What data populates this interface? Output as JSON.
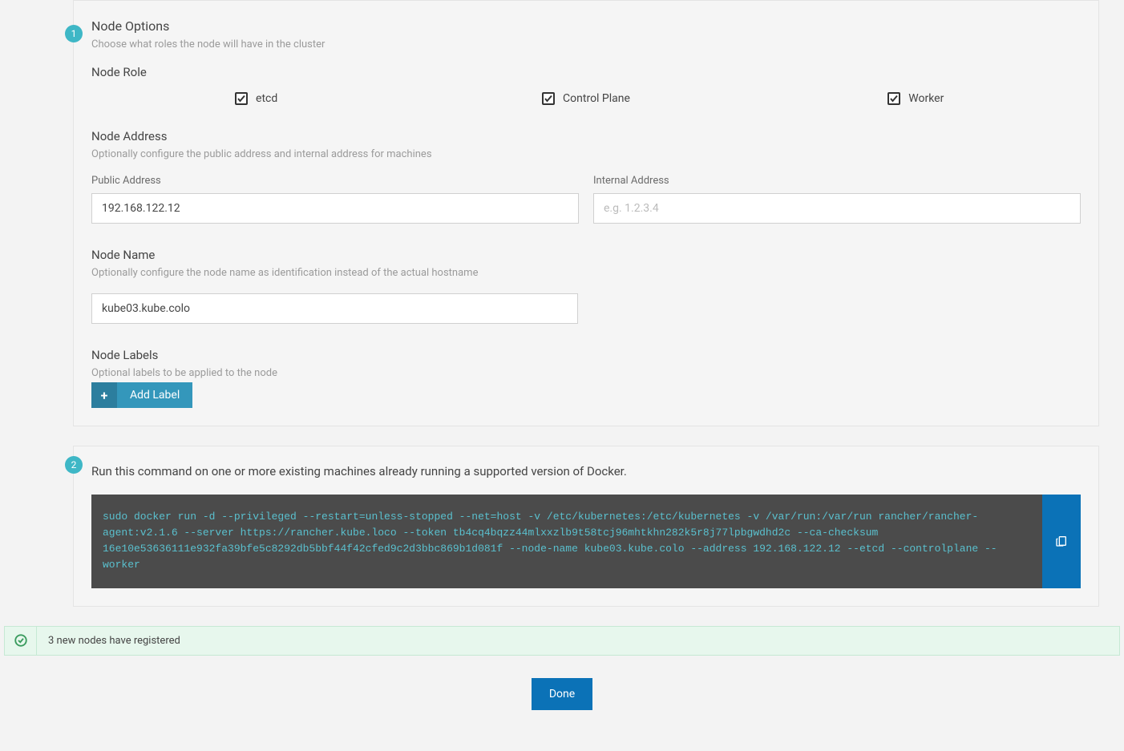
{
  "step1": {
    "badge": "1",
    "title": "Node Options",
    "desc": "Choose what roles the node will have in the cluster",
    "role_title": "Node Role",
    "roles": {
      "etcd": "etcd",
      "control_plane": "Control Plane",
      "worker": "Worker"
    },
    "address": {
      "title": "Node Address",
      "desc": "Optionally configure the public address and internal address for machines",
      "public_label": "Public Address",
      "public_value": "192.168.122.12",
      "internal_label": "Internal Address",
      "internal_placeholder": "e.g. 1.2.3.4",
      "internal_value": ""
    },
    "name": {
      "title": "Node Name",
      "desc": "Optionally configure the node name as identification instead of the actual hostname",
      "value": "kube03.kube.colo"
    },
    "labels": {
      "title": "Node Labels",
      "desc": "Optional labels to be applied to the node",
      "button": "Add Label"
    }
  },
  "step2": {
    "badge": "2",
    "instruction": "Run this command on one or more existing machines already running a supported version of Docker.",
    "command": "sudo docker run -d --privileged --restart=unless-stopped --net=host -v /etc/kubernetes:/etc/kubernetes -v /var/run:/var/run rancher/rancher-agent:v2.1.6 --server https://rancher.kube.loco --token tb4cq4bqzz44mlxxzlb9t58tcj96mhtkhn282k5r8j77lpbgwdhd2c --ca-checksum 16e10e53636111e932fa39bfe5c8292db5bbf44f42cfed9c2d3bbc869b1d081f --node-name kube03.kube.colo --address 192.168.122.12 --etcd --controlplane --worker"
  },
  "status": {
    "message": "3 new nodes have registered"
  },
  "done_label": "Done"
}
